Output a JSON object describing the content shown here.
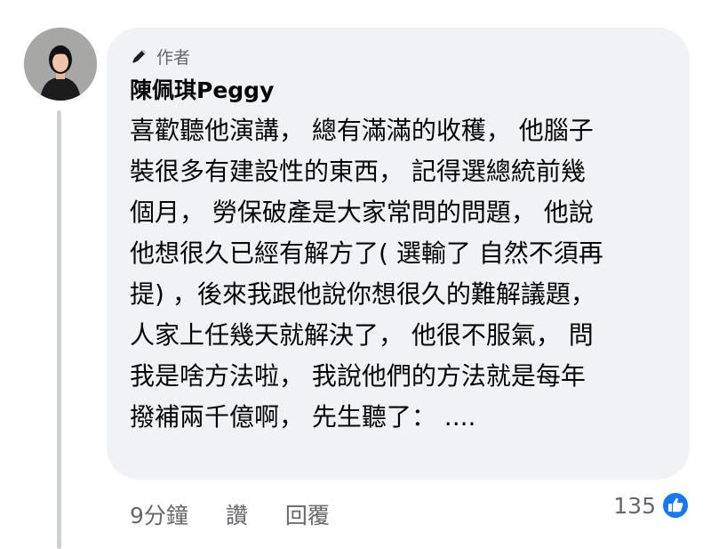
{
  "comment": {
    "author_badge": "作者",
    "author_name": "陳佩琪Peggy",
    "text_lines": [
      "喜歡聽他演講， 總有滿滿的收穫， 他腦子",
      "裝很多有建設性的東西， 記得選總統前幾",
      "個月， 勞保破產是大家常問的問題， 他說",
      "他想很久已經有解方了( 選輸了 自然不須再",
      "提) ，後來我跟他說你想很久的難解議題，",
      "人家上任幾天就解決了， 他很不服氣， 問",
      "我是啥方法啦， 我說他們的方法就是每年",
      "撥補兩千億啊， 先生聽了： ...."
    ]
  },
  "actions": {
    "time": "9分鐘",
    "like_label": "讚",
    "reply_label": "回覆"
  },
  "reactions": {
    "count": "135",
    "icon": "like-icon",
    "color": "#1877f2"
  }
}
